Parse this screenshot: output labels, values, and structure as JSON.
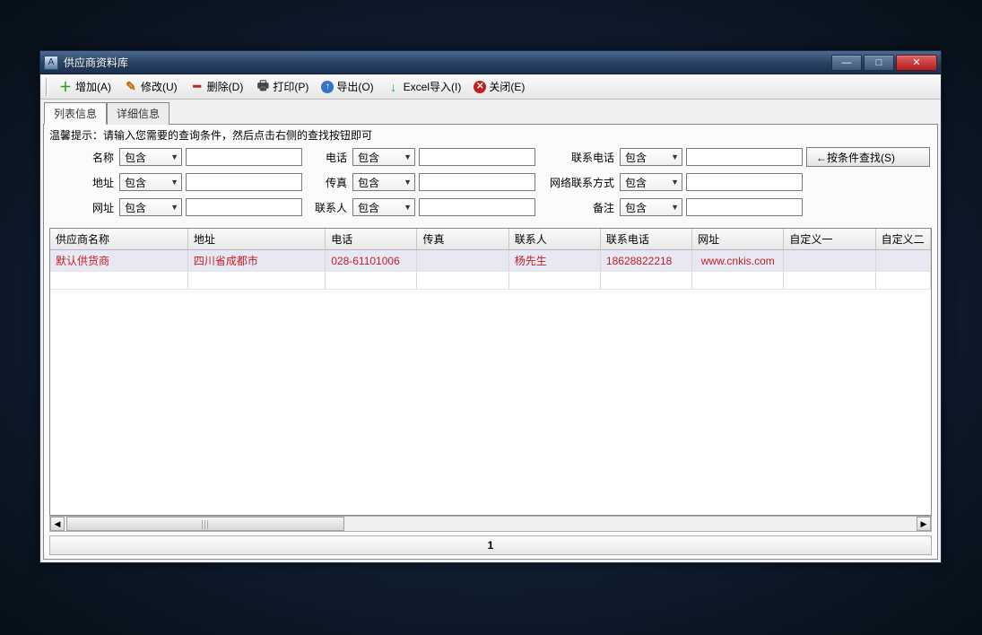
{
  "window": {
    "title": "供应商资料库"
  },
  "toolbar": {
    "add": "增加(A)",
    "edit": "修改(U)",
    "delete": "删除(D)",
    "print": "打印(P)",
    "export": "导出(O)",
    "import": "Excel导入(I)",
    "close": "关闭(E)"
  },
  "tabs": {
    "list": "列表信息",
    "detail": "详细信息"
  },
  "hint": "温馨提示：请输入您需要的查询条件，然后点击右侧的查找按钮即可",
  "filters": {
    "name": {
      "label": "名称",
      "op": "包含",
      "value": ""
    },
    "phone": {
      "label": "电话",
      "op": "包含",
      "value": ""
    },
    "cphone": {
      "label": "联系电话",
      "op": "包含",
      "value": ""
    },
    "addr": {
      "label": "地址",
      "op": "包含",
      "value": ""
    },
    "fax": {
      "label": "传真",
      "op": "包含",
      "value": ""
    },
    "net": {
      "label": "网络联系方式",
      "op": "包含",
      "value": ""
    },
    "url": {
      "label": "网址",
      "op": "包含",
      "value": ""
    },
    "contact": {
      "label": "联系人",
      "op": "包含",
      "value": ""
    },
    "remark": {
      "label": "备注",
      "op": "包含",
      "value": ""
    }
  },
  "search_btn": "←按条件查找(S)",
  "columns": [
    "供应商名称",
    "地址",
    "电话",
    "传真",
    "联系人",
    "联系电话",
    "网址",
    "自定义一",
    "自定义二"
  ],
  "rows": [
    {
      "name": "默认供货商",
      "addr": "四川省成都市",
      "phone": "028-61101006",
      "fax": "",
      "contact": "杨先生",
      "cphone": "18628822218",
      "url": "www.cnkis.com",
      "c1": "",
      "c2": ""
    },
    {
      "name": "",
      "addr": "",
      "phone": "",
      "fax": "",
      "contact": "",
      "cphone": "",
      "url": "",
      "c1": "",
      "c2": ""
    }
  ],
  "pager": {
    "current": "1"
  }
}
